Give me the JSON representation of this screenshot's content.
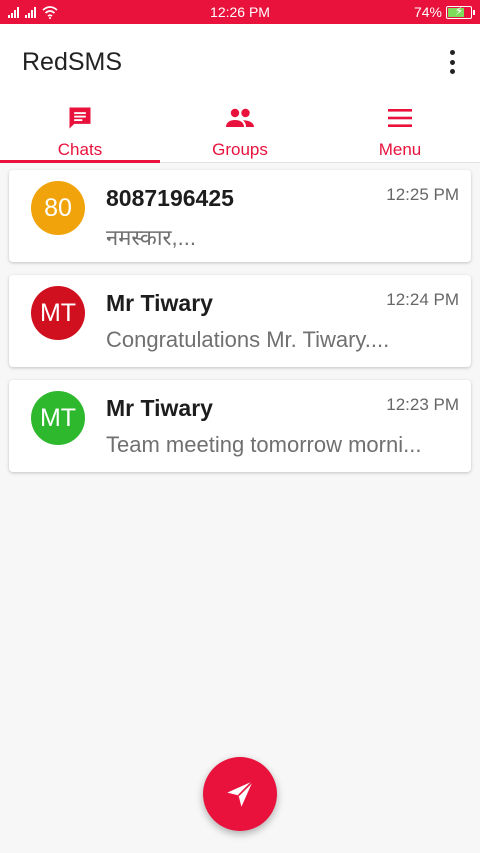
{
  "status_bar": {
    "time": "12:26 PM",
    "battery_text": "74%",
    "battery_level": 0.74,
    "background": "#e8123c"
  },
  "app": {
    "title": "RedSMS",
    "overflow_icon": "more-vert-icon"
  },
  "tabs": [
    {
      "label": "Chats",
      "icon": "chat-icon",
      "active": true
    },
    {
      "label": "Groups",
      "icon": "group-icon",
      "active": false
    },
    {
      "label": "Menu",
      "icon": "menu-icon",
      "active": false
    }
  ],
  "chats": [
    {
      "avatar_text": "80",
      "avatar_color": "#f0a30a",
      "name": "8087196425",
      "time": "12:25 PM",
      "message": "नमस्कार,..."
    },
    {
      "avatar_text": "MT",
      "avatar_color": "#d0101e",
      "name": "Mr Tiwary",
      "time": "12:24 PM",
      "message": "Congratulations Mr. Tiwary...."
    },
    {
      "avatar_text": "MT",
      "avatar_color": "#2db82d",
      "name": "Mr Tiwary",
      "time": "12:23 PM",
      "message": "Team meeting tomorrow morni..."
    }
  ],
  "fab": {
    "icon": "send-icon"
  },
  "colors": {
    "accent": "#e8123c"
  }
}
